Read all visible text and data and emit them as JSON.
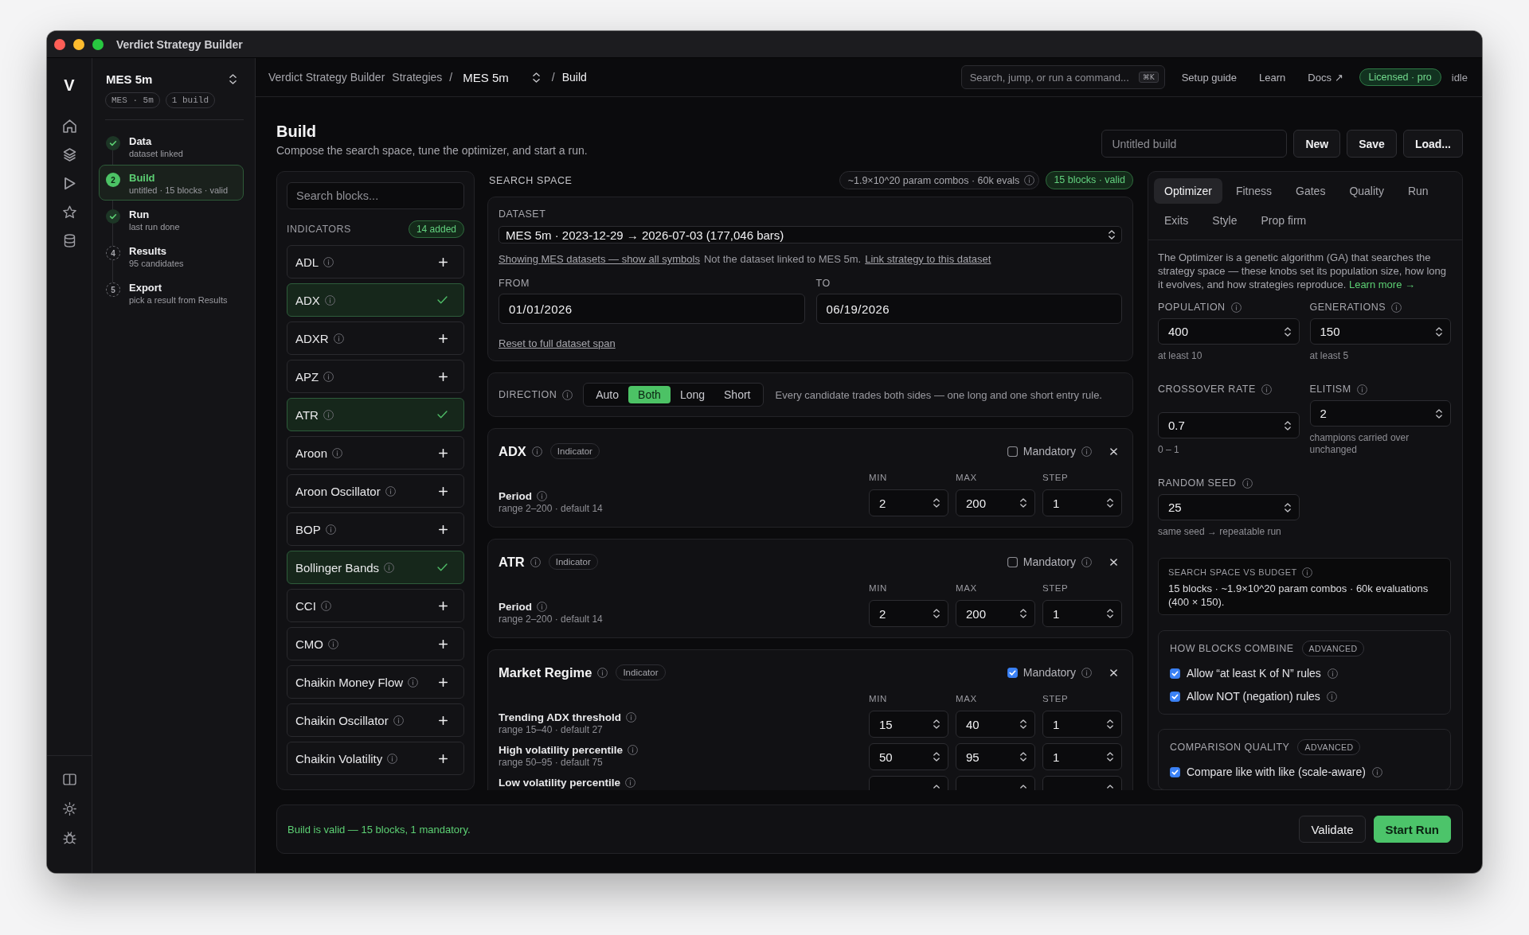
{
  "window": {
    "title": "Verdict Strategy Builder"
  },
  "rail": {
    "logo": "V"
  },
  "sidebar": {
    "project": "MES 5m",
    "chips": [
      "MES · 5m",
      "1 build"
    ],
    "steps": [
      {
        "title": "Data",
        "subtitle": "dataset linked",
        "completed": true,
        "selected": false
      },
      {
        "title": "Build",
        "subtitle": "untitled · 15 blocks · valid",
        "completed": false,
        "number": "2",
        "selected": true
      },
      {
        "title": "Run",
        "subtitle": "last run done",
        "completed": true,
        "selected": false
      },
      {
        "title": "Results",
        "subtitle": "95 candidates",
        "completed": false,
        "number": "4",
        "selected": false
      },
      {
        "title": "Export",
        "subtitle": "pick a result from Results",
        "completed": false,
        "number": "5",
        "selected": false
      }
    ]
  },
  "topbar": {
    "breadcrumb": [
      {
        "kind": "link",
        "label": "Verdict Strategy Builder"
      },
      {
        "kind": "link",
        "label": "Strategies"
      },
      {
        "kind": "separator",
        "label": "/"
      },
      {
        "kind": "select",
        "label": "MES 5m"
      },
      {
        "kind": "separator",
        "label": "/"
      },
      {
        "kind": "current",
        "label": "Build"
      }
    ],
    "command_search": {
      "placeholder": "Search, jump, or run a command...",
      "shortcut": "⌘K"
    },
    "links": [
      "Setup guide",
      "Learn",
      "Docs ↗"
    ],
    "license": "Licensed · pro",
    "status": "idle"
  },
  "header": {
    "title": "Build",
    "subtitle": "Compose the search space, tune the optimizer, and start a run.",
    "build_name": {
      "placeholder": "Untitled build"
    },
    "buttons": [
      "New",
      "Save",
      "Load..."
    ]
  },
  "blocks": {
    "search": {
      "placeholder": "Search blocks..."
    },
    "section": "INDICATORS",
    "added_count": "14 added",
    "items": [
      {
        "name": "ADL",
        "added": false
      },
      {
        "name": "ADX",
        "added": true
      },
      {
        "name": "ADXR",
        "added": false
      },
      {
        "name": "APZ",
        "added": false
      },
      {
        "name": "ATR",
        "added": true
      },
      {
        "name": "Aroon",
        "added": false
      },
      {
        "name": "Aroon Oscillator",
        "added": false
      },
      {
        "name": "BOP",
        "added": false
      },
      {
        "name": "Bollinger Bands",
        "added": true
      },
      {
        "name": "CCI",
        "added": false
      },
      {
        "name": "CMO",
        "added": false
      },
      {
        "name": "Chaikin Money Flow",
        "added": false
      },
      {
        "name": "Chaikin Oscillator",
        "added": false
      },
      {
        "name": "Chaikin Volatility",
        "added": false
      }
    ]
  },
  "search_space": {
    "heading": "SEARCH SPACE",
    "combos": "~1.9×10^20 param combos · 60k evals",
    "validity": "15 blocks · valid",
    "dataset": {
      "label": "DATASET",
      "value": "MES 5m · 2023-12-29 → 2026-07-03 (177,046 bars)",
      "note": [
        {
          "kind": "link",
          "text": "Showing MES datasets — show all symbols"
        },
        {
          "kind": "text",
          "text": "Not the dataset linked to MES 5m."
        },
        {
          "kind": "link",
          "text": "Link strategy to this dataset"
        }
      ],
      "from": {
        "label": "FROM",
        "value": "01/01/2026"
      },
      "to": {
        "label": "TO",
        "value": "06/19/2026"
      },
      "reset_link": "Reset to full dataset span"
    },
    "direction": {
      "label": "DIRECTION",
      "options": [
        {
          "label": "Auto",
          "selected": false
        },
        {
          "label": "Both",
          "selected": true
        },
        {
          "label": "Long",
          "selected": false
        },
        {
          "label": "Short",
          "selected": false
        }
      ],
      "description": "Every candidate trades both sides — one long and one short entry rule."
    },
    "blocks": [
      {
        "name": "ADX",
        "tag": "Indicator",
        "mandatory": false,
        "mandatory_label": "Mandatory",
        "columns": [
          "MIN",
          "MAX",
          "STEP"
        ],
        "params": [
          {
            "name": "Period",
            "hint": "range 2–200 · default 14",
            "min": "2",
            "max": "200",
            "step": "1"
          }
        ]
      },
      {
        "name": "ATR",
        "tag": "Indicator",
        "mandatory": false,
        "mandatory_label": "Mandatory",
        "columns": [
          "MIN",
          "MAX",
          "STEP"
        ],
        "params": [
          {
            "name": "Period",
            "hint": "range 2–200 · default 14",
            "min": "2",
            "max": "200",
            "step": "1"
          }
        ]
      },
      {
        "name": "Market Regime",
        "tag": "Indicator",
        "mandatory": true,
        "mandatory_label": "Mandatory",
        "columns": [
          "MIN",
          "MAX",
          "STEP"
        ],
        "params": [
          {
            "name": "Trending ADX threshold",
            "hint": "range 15–40 · default 27",
            "min": "15",
            "max": "40",
            "step": "1"
          },
          {
            "name": "High volatility percentile",
            "hint": "range 50–95 · default 75",
            "min": "50",
            "max": "95",
            "step": "1"
          },
          {
            "name": "Low volatility percentile"
          }
        ]
      }
    ]
  },
  "settings": {
    "tabs": [
      {
        "label": "Optimizer",
        "selected": true
      },
      {
        "label": "Fitness",
        "selected": false
      },
      {
        "label": "Gates",
        "selected": false
      },
      {
        "label": "Quality",
        "selected": false
      },
      {
        "label": "Run",
        "selected": false
      },
      {
        "label": "Exits",
        "selected": false
      },
      {
        "label": "Style",
        "selected": false
      },
      {
        "label": "Prop firm",
        "selected": false
      }
    ],
    "description": "The Optimizer is a genetic algorithm (GA) that searches the strategy space — these knobs set its population size, how long it evolves, and how strategies reproduce.",
    "learn_more": "Learn more →",
    "fields": [
      {
        "label": "POPULATION",
        "value": "400",
        "hint": "at least 10"
      },
      {
        "label": "GENERATIONS",
        "value": "150",
        "hint": "at least 5"
      },
      {
        "label": "CROSSOVER RATE",
        "value": "0.7",
        "hint": "0 – 1"
      },
      {
        "label": "ELITISM",
        "value": "2",
        "hint": "champions carried over unchanged"
      },
      {
        "label": "RANDOM SEED",
        "value": "25",
        "hint": "same seed → repeatable run"
      }
    ],
    "budget": {
      "heading": "SEARCH SPACE VS BUDGET",
      "text": "15 blocks · ~1.9×10^20 param combos · 60k evaluations (400 × 150)."
    },
    "groups": [
      {
        "heading": "HOW BLOCKS COMBINE",
        "badge": "ADVANCED",
        "options": [
          {
            "label": "Allow “at least K of N” rules",
            "checked": true
          },
          {
            "label": "Allow NOT (negation) rules",
            "checked": true
          }
        ]
      },
      {
        "heading": "COMPARISON QUALITY",
        "badge": "ADVANCED",
        "options": [
          {
            "label": "Compare like with like (scale-aware)",
            "checked": true
          }
        ]
      }
    ]
  },
  "footer": {
    "message": "Build is valid — 15 blocks, 1 mandatory.",
    "buttons": [
      {
        "label": "Validate",
        "kind": "secondary"
      },
      {
        "label": "Start Run",
        "kind": "primary"
      }
    ]
  }
}
